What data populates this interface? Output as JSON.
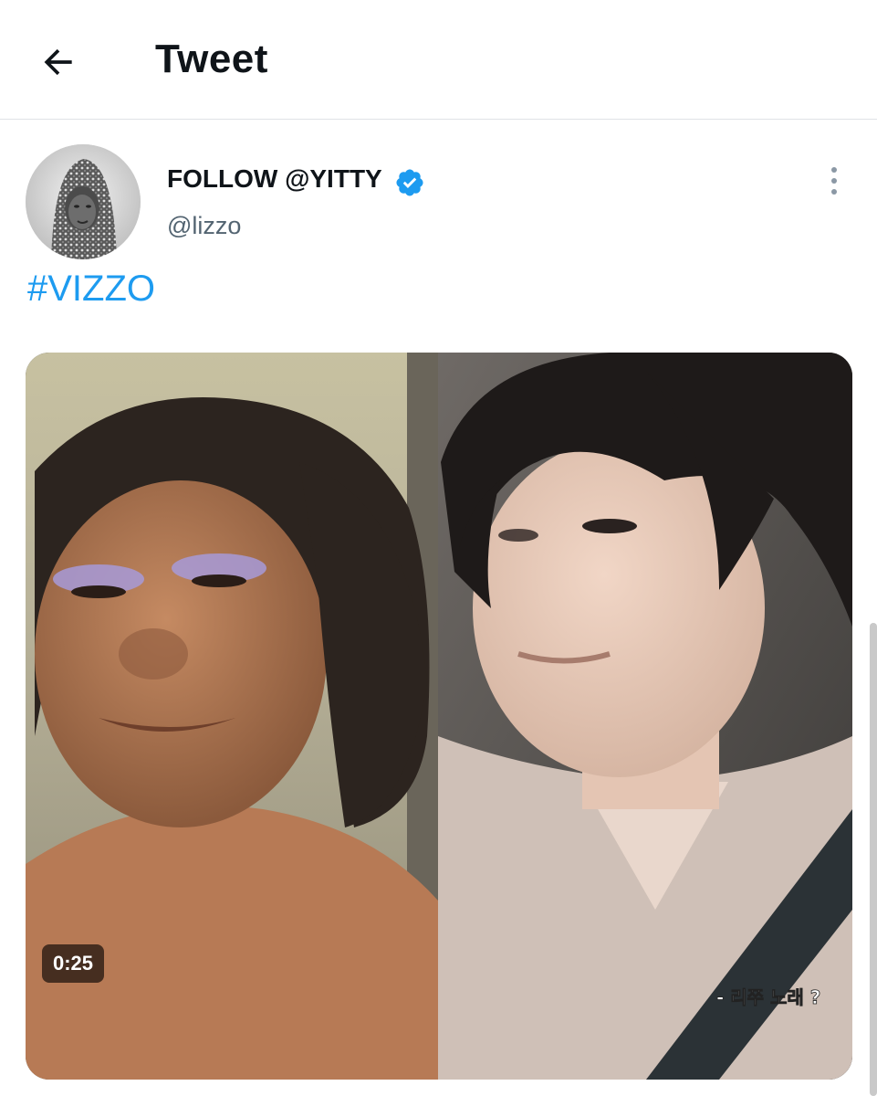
{
  "header": {
    "title": "Tweet",
    "back_icon": "arrow-left-icon"
  },
  "tweet": {
    "author": {
      "display_name": "FOLLOW @YITTY",
      "handle": "@lizzo",
      "verified": true,
      "verified_color": "#1d9bf0"
    },
    "text": "#VIZZO",
    "media": {
      "type": "video",
      "duration": "0:25",
      "caption_overlay": "- 리쭈 노래 ?"
    }
  },
  "colors": {
    "link": "#1d9bf0",
    "secondary_text": "#536471"
  }
}
